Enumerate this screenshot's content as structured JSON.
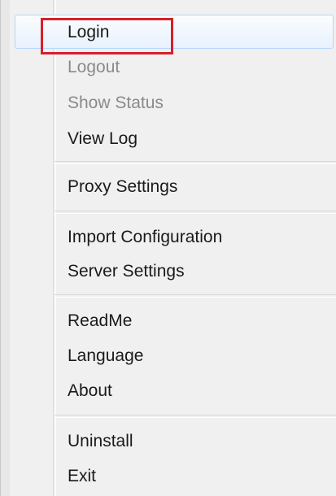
{
  "menu": {
    "items": [
      {
        "label": "Login",
        "enabled": true
      },
      {
        "label": "Logout",
        "enabled": false
      },
      {
        "label": "Show Status",
        "enabled": false
      },
      {
        "label": "View Log",
        "enabled": true
      },
      {
        "label": "Proxy Settings",
        "enabled": true
      },
      {
        "label": "Import Configuration",
        "enabled": true
      },
      {
        "label": "Server Settings",
        "enabled": true
      },
      {
        "label": "ReadMe",
        "enabled": true
      },
      {
        "label": "Language",
        "enabled": true
      },
      {
        "label": "About",
        "enabled": true
      },
      {
        "label": "Uninstall",
        "enabled": true
      },
      {
        "label": "Exit",
        "enabled": true
      }
    ],
    "highlight_color": "#d6202a"
  }
}
